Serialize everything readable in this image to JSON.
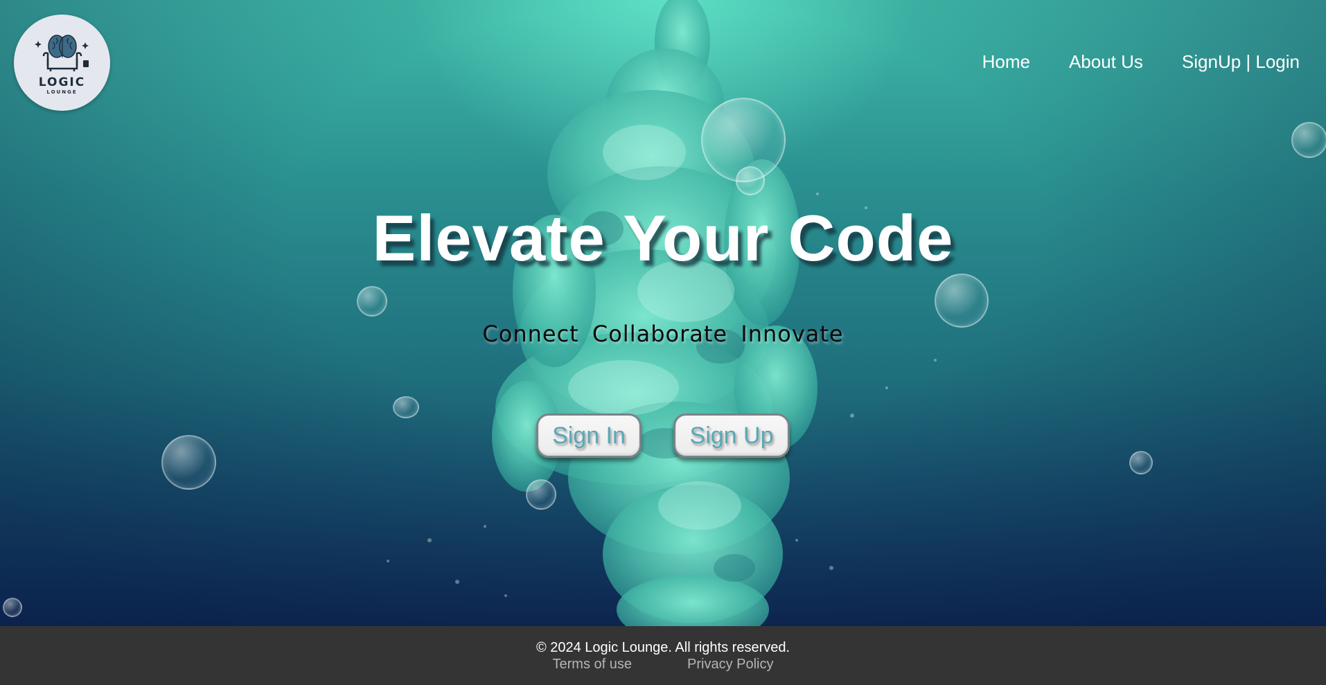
{
  "brand": {
    "logo_word": "LOGIC",
    "logo_sub": "LOUNGE"
  },
  "nav": {
    "items": [
      {
        "label": "Home"
      },
      {
        "label": "About Us"
      },
      {
        "label": "SignUp | Login"
      }
    ]
  },
  "hero": {
    "headline": "Elevate Your Code",
    "tagline": "Connect Collaborate Innovate",
    "signin_label": "Sign In",
    "signup_label": "Sign Up"
  },
  "footer": {
    "copyright": "© 2024 Logic Lounge. All rights reserved.",
    "terms_label": "Terms of use",
    "privacy_label": "Privacy Policy"
  },
  "colors": {
    "hero_top": "#3fb9a8",
    "hero_bottom": "#0f2a55",
    "footer_bg": "#343434",
    "button_text": "#5aa8b5"
  }
}
